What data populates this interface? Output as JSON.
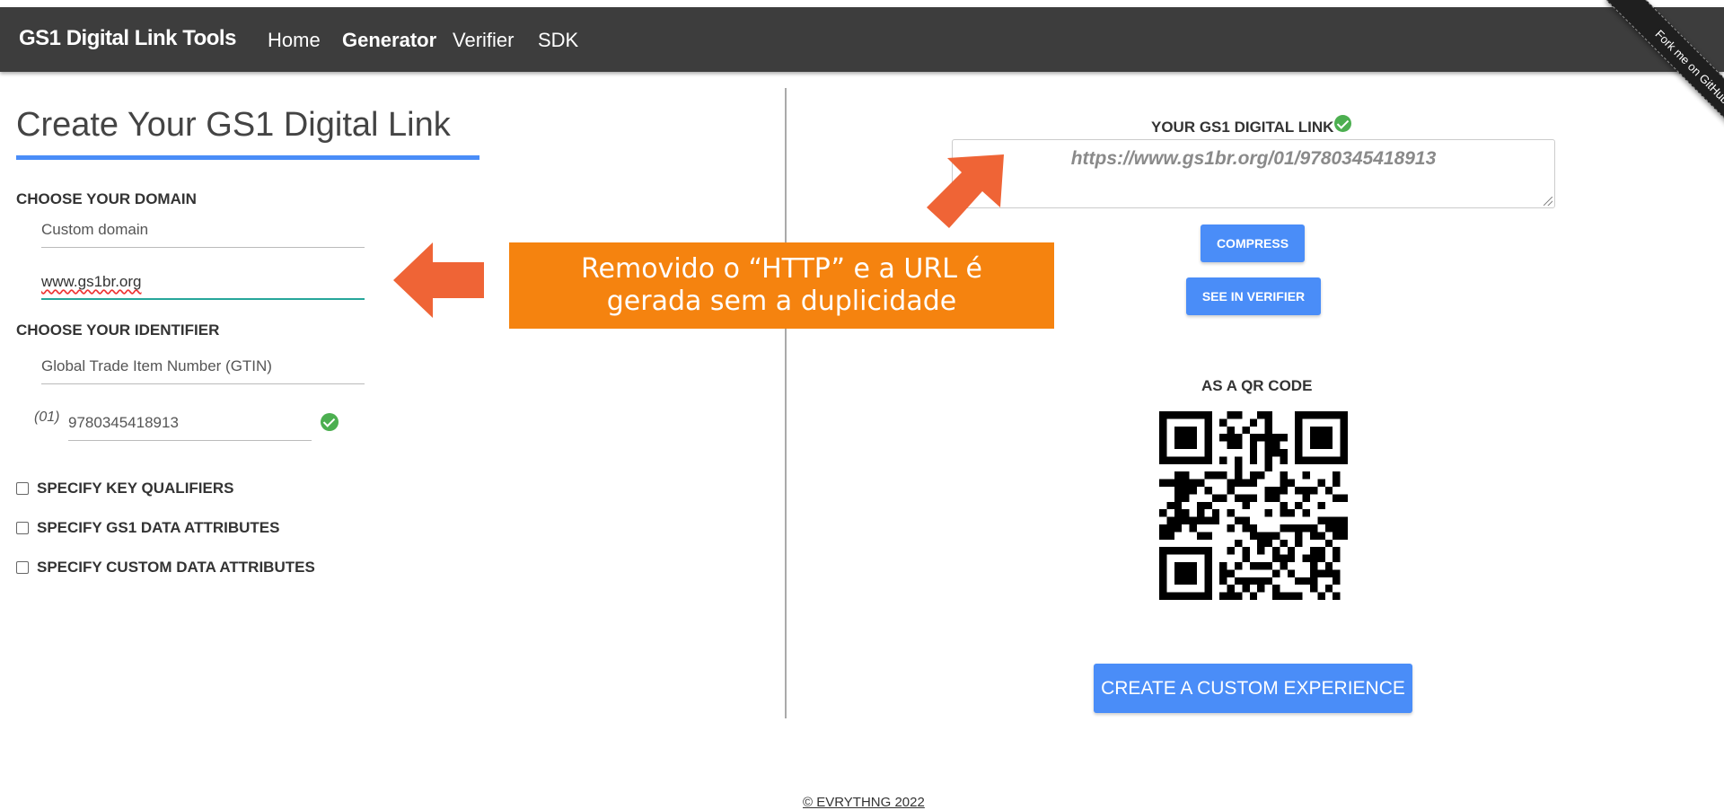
{
  "navbar": {
    "brand": "GS1 Digital Link Tools",
    "links": [
      {
        "label": "Home",
        "active": false
      },
      {
        "label": "Generator",
        "active": true
      },
      {
        "label": "Verifier",
        "active": false
      },
      {
        "label": "SDK",
        "active": false
      }
    ],
    "ribbon": "Fork me on GitHub"
  },
  "left": {
    "title": "Create Your GS1 Digital Link",
    "domain": {
      "label": "CHOOSE YOUR DOMAIN",
      "select_value": "Custom domain",
      "input_value": "www.gs1br.org"
    },
    "identifier": {
      "label": "CHOOSE YOUR IDENTIFIER",
      "select_value": "Global Trade Item Number (GTIN)",
      "prefix": "(01)",
      "input_value": "9780345418913"
    },
    "checkboxes": [
      {
        "label": "SPECIFY KEY QUALIFIERS",
        "checked": false
      },
      {
        "label": "SPECIFY GS1 DATA ATTRIBUTES",
        "checked": false
      },
      {
        "label": "SPECIFY CUSTOM DATA ATTRIBUTES",
        "checked": false
      }
    ]
  },
  "right": {
    "link_label": "YOUR GS1 DIGITAL LINK",
    "link_value": "https://www.gs1br.org/01/9780345418913",
    "compress_label": "COMPRESS",
    "verifier_label": "SEE IN VERIFIER",
    "qr_label": "AS A QR CODE",
    "custom_label": "CREATE A CUSTOM EXPERIENCE"
  },
  "annotation": {
    "text_line1": "Removido o “HTTP” e a URL é",
    "text_line2": "gerada sem a duplicidade"
  },
  "footer": "© EVRYTHNG 2022",
  "colors": {
    "navbar": "#3d3d3d",
    "accent": "#4a8df8",
    "callout": "#f5830f",
    "arrow": "#ef6436",
    "success": "#4caf50"
  },
  "icons": [
    "check-circle-icon",
    "arrow-left-icon",
    "arrow-up-right-icon",
    "qr-code-image",
    "resize-handle-icon"
  ]
}
